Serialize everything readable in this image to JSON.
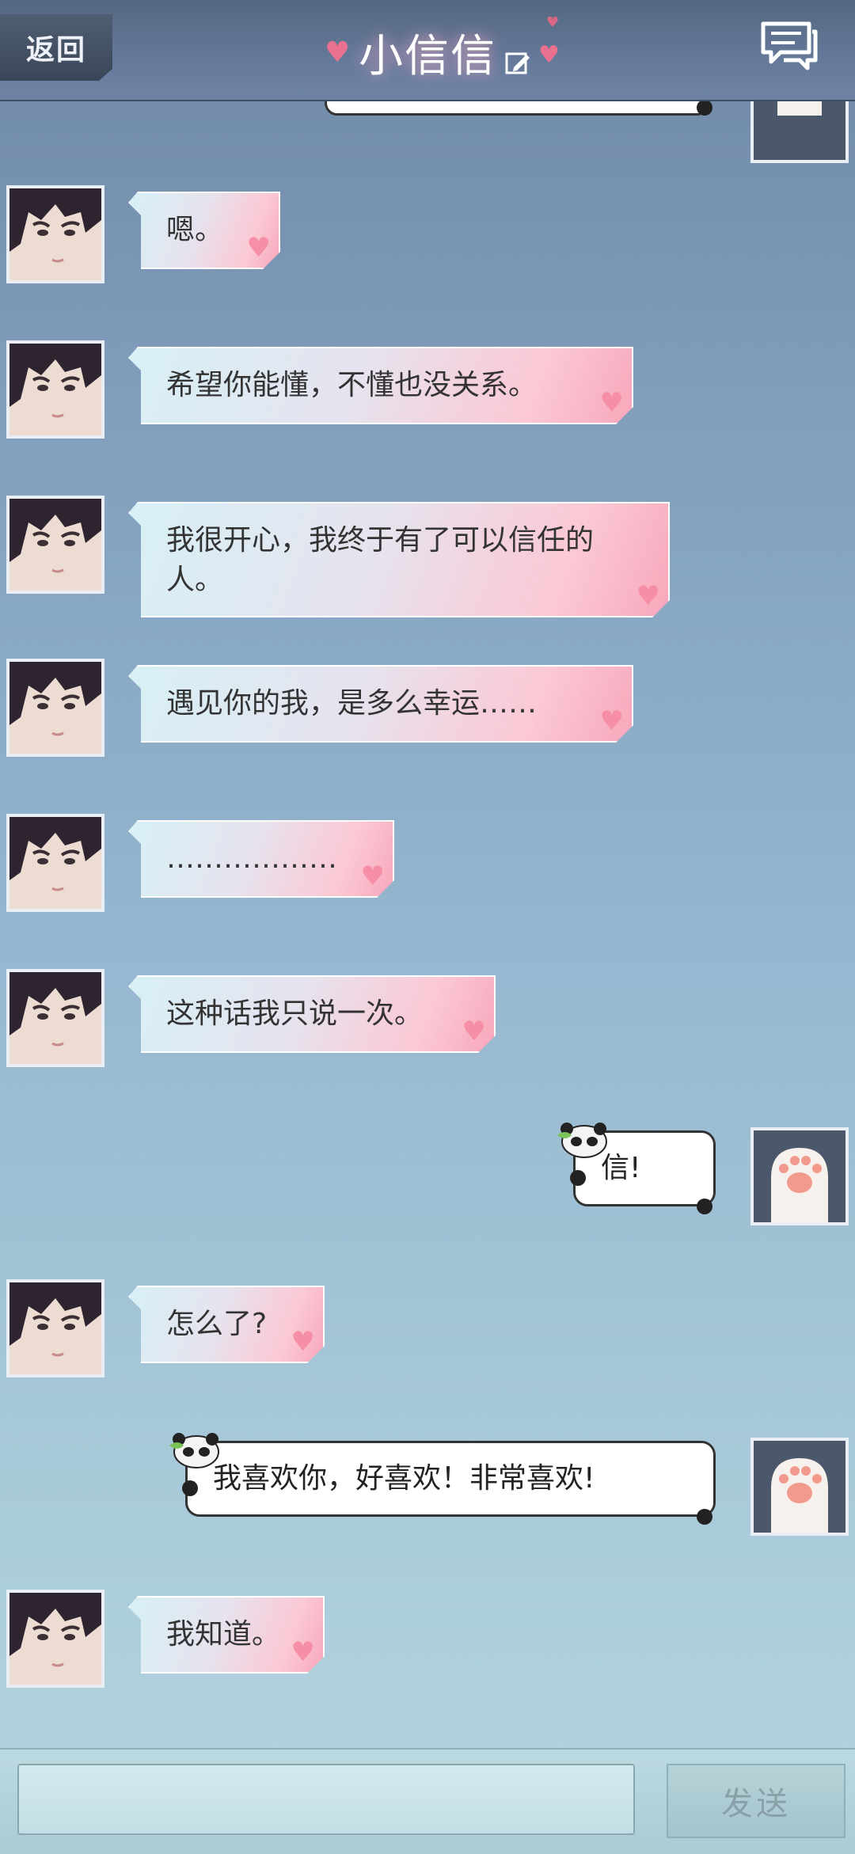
{
  "header": {
    "back_label": "返回",
    "title": "小信信",
    "edit_icon": "edit-icon",
    "chat_icon": "chat-list-icon"
  },
  "messages": [
    {
      "from": "npc",
      "text": "嗯。"
    },
    {
      "from": "npc",
      "text": "希望你能懂，不懂也没关系。"
    },
    {
      "from": "npc",
      "text": "我很开心，我终于有了可以信任的人。"
    },
    {
      "from": "npc",
      "text": "遇见你的我，是多么幸运……"
    },
    {
      "from": "npc",
      "text": "………………"
    },
    {
      "from": "npc",
      "text": "这种话我只说一次。"
    },
    {
      "from": "me",
      "text": "信!"
    },
    {
      "from": "npc",
      "text": "怎么了?"
    },
    {
      "from": "me",
      "text": "我喜欢你，好喜欢！非常喜欢!"
    },
    {
      "from": "npc",
      "text": "我知道。"
    }
  ],
  "input": {
    "value": "",
    "send_label": "发送"
  },
  "colors": {
    "npc_bubble_start": "#d7f0f6",
    "npc_bubble_end": "#f7a8bb",
    "heart": "#f58ea6",
    "header": "#5f7391"
  }
}
